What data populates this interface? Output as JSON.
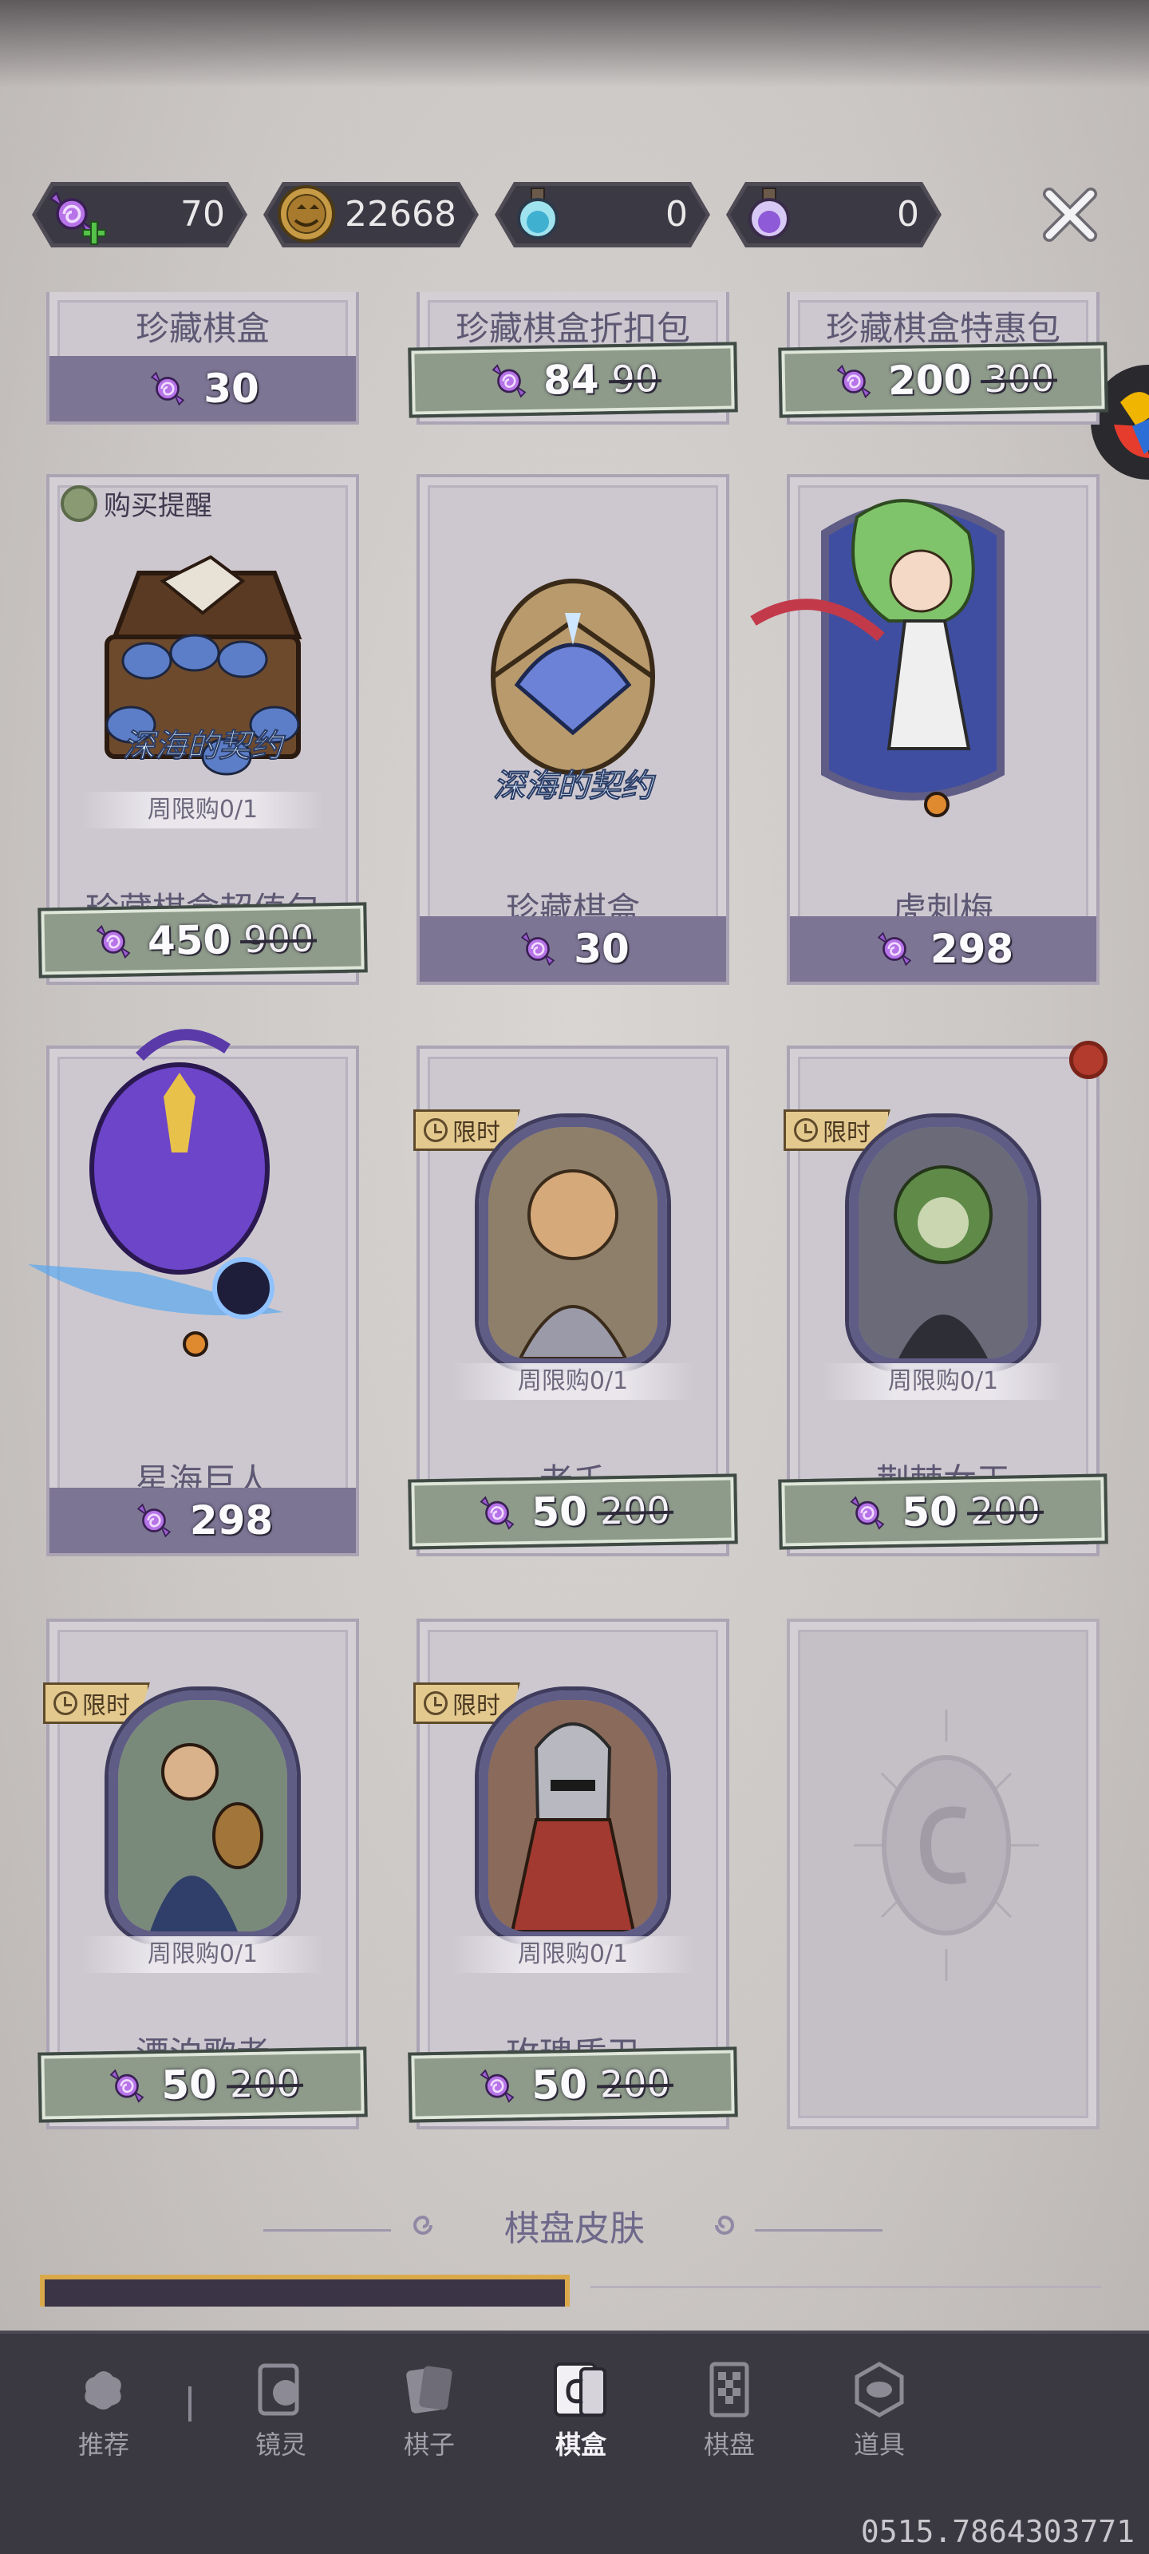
{
  "currencies": [
    {
      "name": "candy",
      "icon": "candy-plus-icon",
      "value": "70"
    },
    {
      "name": "gold",
      "icon": "pumpkin-coin-icon",
      "value": "22668"
    },
    {
      "name": "potion-blue",
      "icon": "blue-potion-icon",
      "value": "0"
    },
    {
      "name": "potion-purple",
      "icon": "purple-potion-icon",
      "value": "0"
    }
  ],
  "items": [
    {
      "name": "珍藏棋盒",
      "price": "30"
    },
    {
      "name": "珍藏棋盒折扣包",
      "price": "84",
      "old_price": "90"
    },
    {
      "name": "珍藏棋盒特惠包",
      "price": "200",
      "old_price": "300"
    },
    {
      "name": "珍藏棋盒超值包",
      "price": "450",
      "old_price": "900",
      "limit": "周限购0/1",
      "reminder": "购买提醒",
      "art_caption": "深海的契约"
    },
    {
      "name": "珍藏棋盒",
      "price": "30",
      "art_caption": "深海的契约"
    },
    {
      "name": "虎刺梅",
      "price": "298"
    },
    {
      "name": "星海巨人",
      "price": "298"
    },
    {
      "name": "老千",
      "price": "50",
      "old_price": "200",
      "limit": "周限购0/1",
      "tag": "限时"
    },
    {
      "name": "荆棘女王",
      "price": "50",
      "old_price": "200",
      "limit": "周限购0/1",
      "tag": "限时"
    },
    {
      "name": "漂泊歌者",
      "price": "50",
      "old_price": "200",
      "limit": "周限购0/1",
      "tag": "限时"
    },
    {
      "name": "玫瑰盾卫",
      "price": "50",
      "old_price": "200",
      "limit": "周限购0/1",
      "tag": "限时"
    }
  ],
  "section_title": "棋盘皮肤",
  "nav": [
    {
      "label": "推荐",
      "icon": "recommend-icon"
    },
    {
      "label": "镜灵",
      "icon": "spirit-icon"
    },
    {
      "label": "棋子",
      "icon": "chess-piece-icon"
    },
    {
      "label": "棋盒",
      "icon": "chess-box-icon",
      "active": true
    },
    {
      "label": "棋盘",
      "icon": "chess-board-icon"
    },
    {
      "label": "道具",
      "icon": "props-icon"
    }
  ],
  "watermark": "0515.7864303771",
  "colors": {
    "price_plain": "#7d7594",
    "price_sale": "#8e9b8a",
    "nav_bg": "#3a3942",
    "tag": "#e4c98f"
  }
}
